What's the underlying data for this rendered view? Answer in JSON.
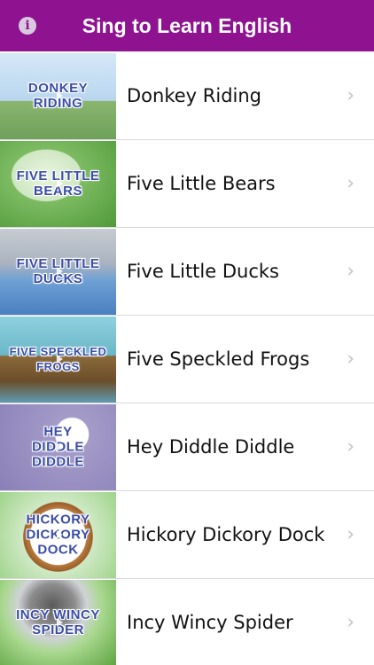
{
  "header": {
    "title": "Sing to Learn English",
    "info_icon": "i"
  },
  "songs": [
    {
      "label": "Donkey Riding",
      "thumb_text": "DONKEY\nRIDING",
      "bg": [
        "#c8e0f4",
        "#7fb070"
      ]
    },
    {
      "label": "Five Little Bears",
      "thumb_text": "FIVE LITTLE\nBEARS",
      "bg": [
        "#9fd28a",
        "#4e9a3c"
      ]
    },
    {
      "label": "Five Little Ducks",
      "thumb_text": "FIVE LITTLE\nDUCKS",
      "bg": [
        "#b8c4d4",
        "#5a8fc8"
      ]
    },
    {
      "label": "Five Speckled Frogs",
      "thumb_text": "FIVE SPECKLED\nFROGS",
      "bg": [
        "#7fc7d9",
        "#4b8c6a"
      ]
    },
    {
      "label": "Hey Diddle Diddle",
      "thumb_text": "HEY\nDIDDLE\nDIDDLE",
      "bg": [
        "#a49bc8",
        "#7b72a8"
      ]
    },
    {
      "label": "Hickory Dickory Dock",
      "thumb_text": "HICKORY\nDICKORY\nDOCK",
      "bg": [
        "#cfe9c5",
        "#7fbf6a"
      ]
    },
    {
      "label": "Incy Wincy Spider",
      "thumb_text": "INCY WINCY\nSPIDER",
      "bg": [
        "#a9d88f",
        "#5ea440"
      ]
    }
  ]
}
